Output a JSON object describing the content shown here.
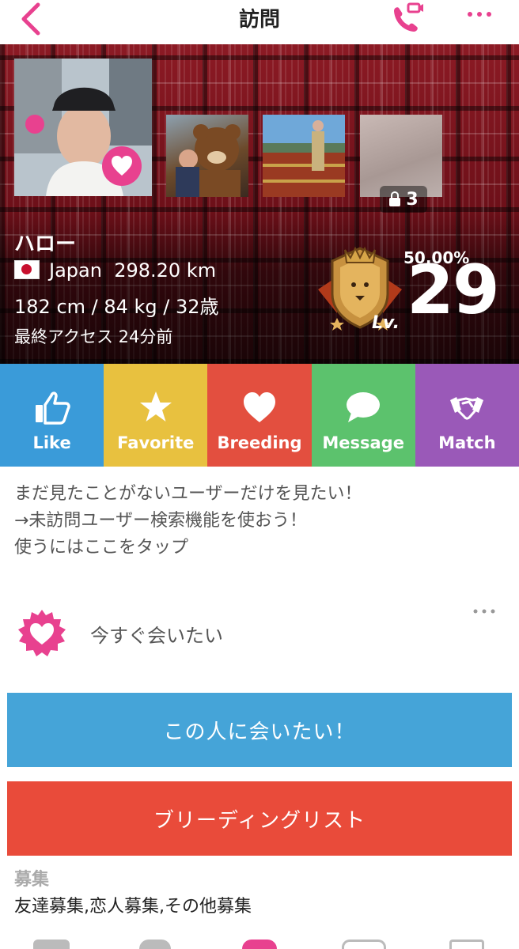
{
  "nav": {
    "title": "訪問",
    "back_icon": "chevron-left-icon",
    "call_icon": "video-call-icon",
    "more_icon": "more-horizontal-icon",
    "accent": "#e8418f"
  },
  "profile": {
    "name": "ハロー",
    "country": "Japan",
    "distance": "298.20 km",
    "stats": "182 cm / 84 kg / 32歳",
    "last_access": "最終アクセス 24分前",
    "locked_photos": "3",
    "level_percent": "50.00%",
    "level_prefix": "Lv.",
    "level": "29"
  },
  "actions": [
    {
      "label": "Like",
      "icon": "thumbs-up-icon",
      "color": "#3a9bd9"
    },
    {
      "label": "Favorite",
      "icon": "star-icon",
      "color": "#e8c13f"
    },
    {
      "label": "Breeding",
      "icon": "heart-icon",
      "color": "#e34f3f"
    },
    {
      "label": "Message",
      "icon": "chat-bubble-icon",
      "color": "#5cc26d"
    },
    {
      "label": "Match",
      "icon": "handshake-icon",
      "color": "#9a59b8"
    }
  ],
  "promo": {
    "line1": "まだ見たことがないユーザーだけを見たい！",
    "line2": "→未訪問ユーザー検索機能を使おう！",
    "line3": "使うにはここをタップ"
  },
  "status": {
    "text": "今すぐ会いたい",
    "icon": "heart-badge-icon"
  },
  "buttons": {
    "meet": "この人に会いたい！",
    "breeding_list": "ブリーディングリスト"
  },
  "recruit": {
    "label": "募集",
    "value": "友達募集,恋人募集,その他募集"
  }
}
